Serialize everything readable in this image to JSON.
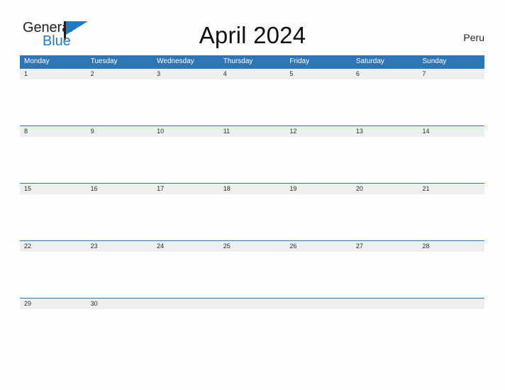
{
  "brand": {
    "word_one": "General",
    "word_two": "Blue",
    "flag_icon": "blue-flag-triangle-icon",
    "colors": {
      "dark": "#231f20",
      "blue": "#1f7ac4"
    }
  },
  "header": {
    "title": "April 2024",
    "country": "Peru"
  },
  "theme": {
    "header_blue": "#2e75b6",
    "band_gray": "#efefef",
    "page_background": "#fefefe",
    "date_text": "#2b2b2b",
    "weekday_text": "#ffffff"
  },
  "calendar": {
    "month": "April",
    "year": "2024",
    "weekday_headers": [
      "Monday",
      "Tuesday",
      "Wednesday",
      "Thursday",
      "Friday",
      "Saturday",
      "Sunday"
    ],
    "weeks": [
      {
        "days": [
          "1",
          "2",
          "3",
          "4",
          "5",
          "6",
          "7"
        ]
      },
      {
        "days": [
          "8",
          "9",
          "10",
          "11",
          "12",
          "13",
          "14"
        ]
      },
      {
        "days": [
          "15",
          "16",
          "17",
          "18",
          "19",
          "20",
          "21"
        ]
      },
      {
        "days": [
          "22",
          "23",
          "24",
          "25",
          "26",
          "27",
          "28"
        ]
      },
      {
        "days": [
          "29",
          "30",
          "",
          "",
          "",
          "",
          ""
        ]
      }
    ]
  }
}
